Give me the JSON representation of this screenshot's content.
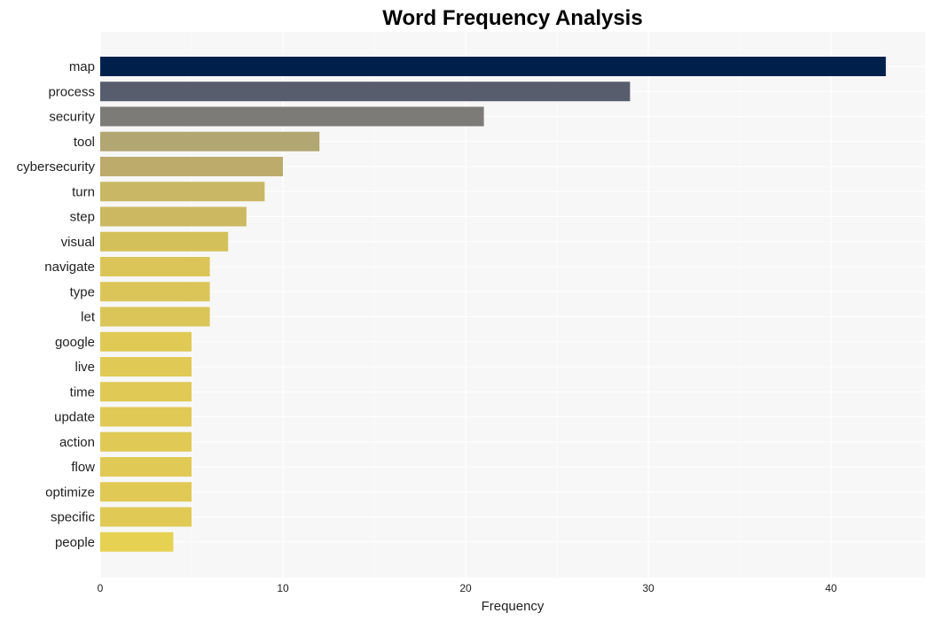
{
  "chart_data": {
    "type": "bar",
    "orientation": "horizontal",
    "title": "Word Frequency Analysis",
    "xlabel": "Frequency",
    "ylabel": "",
    "xlim": [
      0,
      45
    ],
    "xticks": [
      0,
      10,
      20,
      30,
      40
    ],
    "grid": true,
    "categories": [
      "map",
      "process",
      "security",
      "tool",
      "cybersecurity",
      "turn",
      "step",
      "visual",
      "navigate",
      "type",
      "let",
      "google",
      "live",
      "time",
      "update",
      "action",
      "flow",
      "optimize",
      "specific",
      "people"
    ],
    "values": [
      43,
      29,
      21,
      12,
      10,
      9,
      8,
      7,
      6,
      6,
      6,
      5,
      5,
      5,
      5,
      5,
      5,
      5,
      5,
      4
    ],
    "colors": [
      "#00204c",
      "#575d6d",
      "#7c7b78",
      "#b2a672",
      "#bdab6b",
      "#c9b765",
      "#cbb861",
      "#d4c05a",
      "#dbc559",
      "#dbc559",
      "#dbc559",
      "#e0c955",
      "#e0c955",
      "#e0c955",
      "#e0c955",
      "#e0c955",
      "#e0c955",
      "#e0c955",
      "#e0c955",
      "#e6d153"
    ]
  }
}
